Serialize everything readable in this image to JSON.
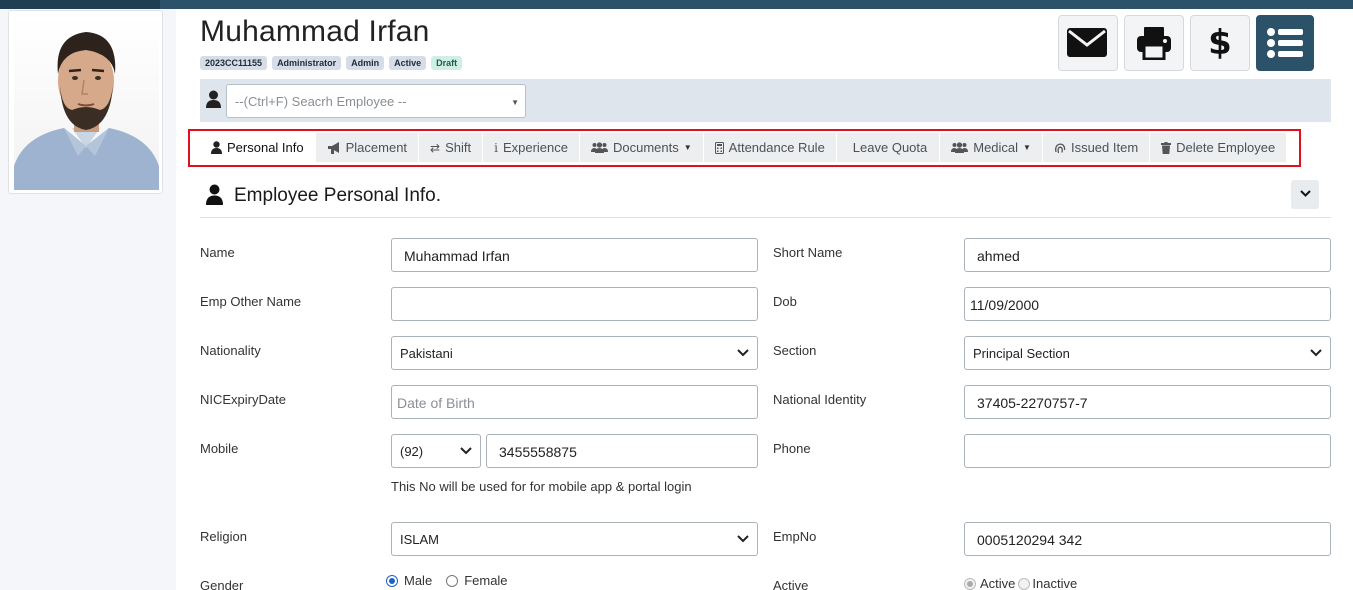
{
  "employee": {
    "name": "Muhammad Irfan",
    "badges": [
      "2023CC11155",
      "Administrator",
      "Admin",
      "Active",
      "Draft"
    ]
  },
  "actions": {
    "email_icon": "envelope-icon",
    "print_icon": "printer-icon",
    "pay_icon": "dollar-icon",
    "menu_icon": "list-icon"
  },
  "search": {
    "placeholder": "--(Ctrl+F) Seacrh Employee --"
  },
  "tabs": [
    {
      "label": "Personal Info",
      "icon": "user-icon"
    },
    {
      "label": "Placement",
      "icon": "bullhorn-icon"
    },
    {
      "label": "Shift",
      "icon": "exchange-icon"
    },
    {
      "label": "Experience",
      "icon": "info-icon"
    },
    {
      "label": "Documents",
      "icon": "users-icon"
    },
    {
      "label": "Attendance Rule",
      "icon": "calculator-icon"
    },
    {
      "label": "Leave Quota",
      "icon": ""
    },
    {
      "label": "Medical",
      "icon": "users-icon"
    },
    {
      "label": "Issued Item",
      "icon": "fingerprint-icon"
    },
    {
      "label": "Delete Employee",
      "icon": "trash-icon"
    }
  ],
  "section": {
    "title": "Employee Personal Info."
  },
  "form": {
    "name": {
      "label": "Name",
      "value": "Muhammad Irfan"
    },
    "short_name": {
      "label": "Short Name",
      "value": "ahmed"
    },
    "other_name": {
      "label": "Emp Other Name",
      "value": ""
    },
    "dob": {
      "label": "Dob",
      "value": "11/09/2000"
    },
    "nationality": {
      "label": "Nationality",
      "value": "Pakistani"
    },
    "section": {
      "label": "Section",
      "value": "Principal Section"
    },
    "nic_expiry": {
      "label": "NICExpiryDate",
      "placeholder": "Date of Birth"
    },
    "national_identity": {
      "label": "National Identity",
      "value": "37405-2270757-7"
    },
    "mobile": {
      "label": "Mobile",
      "code": "(92)",
      "value": "3455558875",
      "help": "This No will be used for for mobile app & portal login"
    },
    "phone": {
      "label": "Phone",
      "value": ""
    },
    "religion": {
      "label": "Religion",
      "value": "ISLAM"
    },
    "empno": {
      "label": "EmpNo",
      "value": "0005120294 342"
    },
    "gender": {
      "label": "Gender",
      "options": [
        "Male",
        "Female"
      ],
      "selected": "Male"
    },
    "active": {
      "label": "Active",
      "options": [
        "Active",
        "Inactive"
      ],
      "selected": "Active"
    }
  },
  "colors": {
    "brand": "#2b5268",
    "highlight": "#e2101f",
    "draft_badge": "#cfeee5"
  }
}
